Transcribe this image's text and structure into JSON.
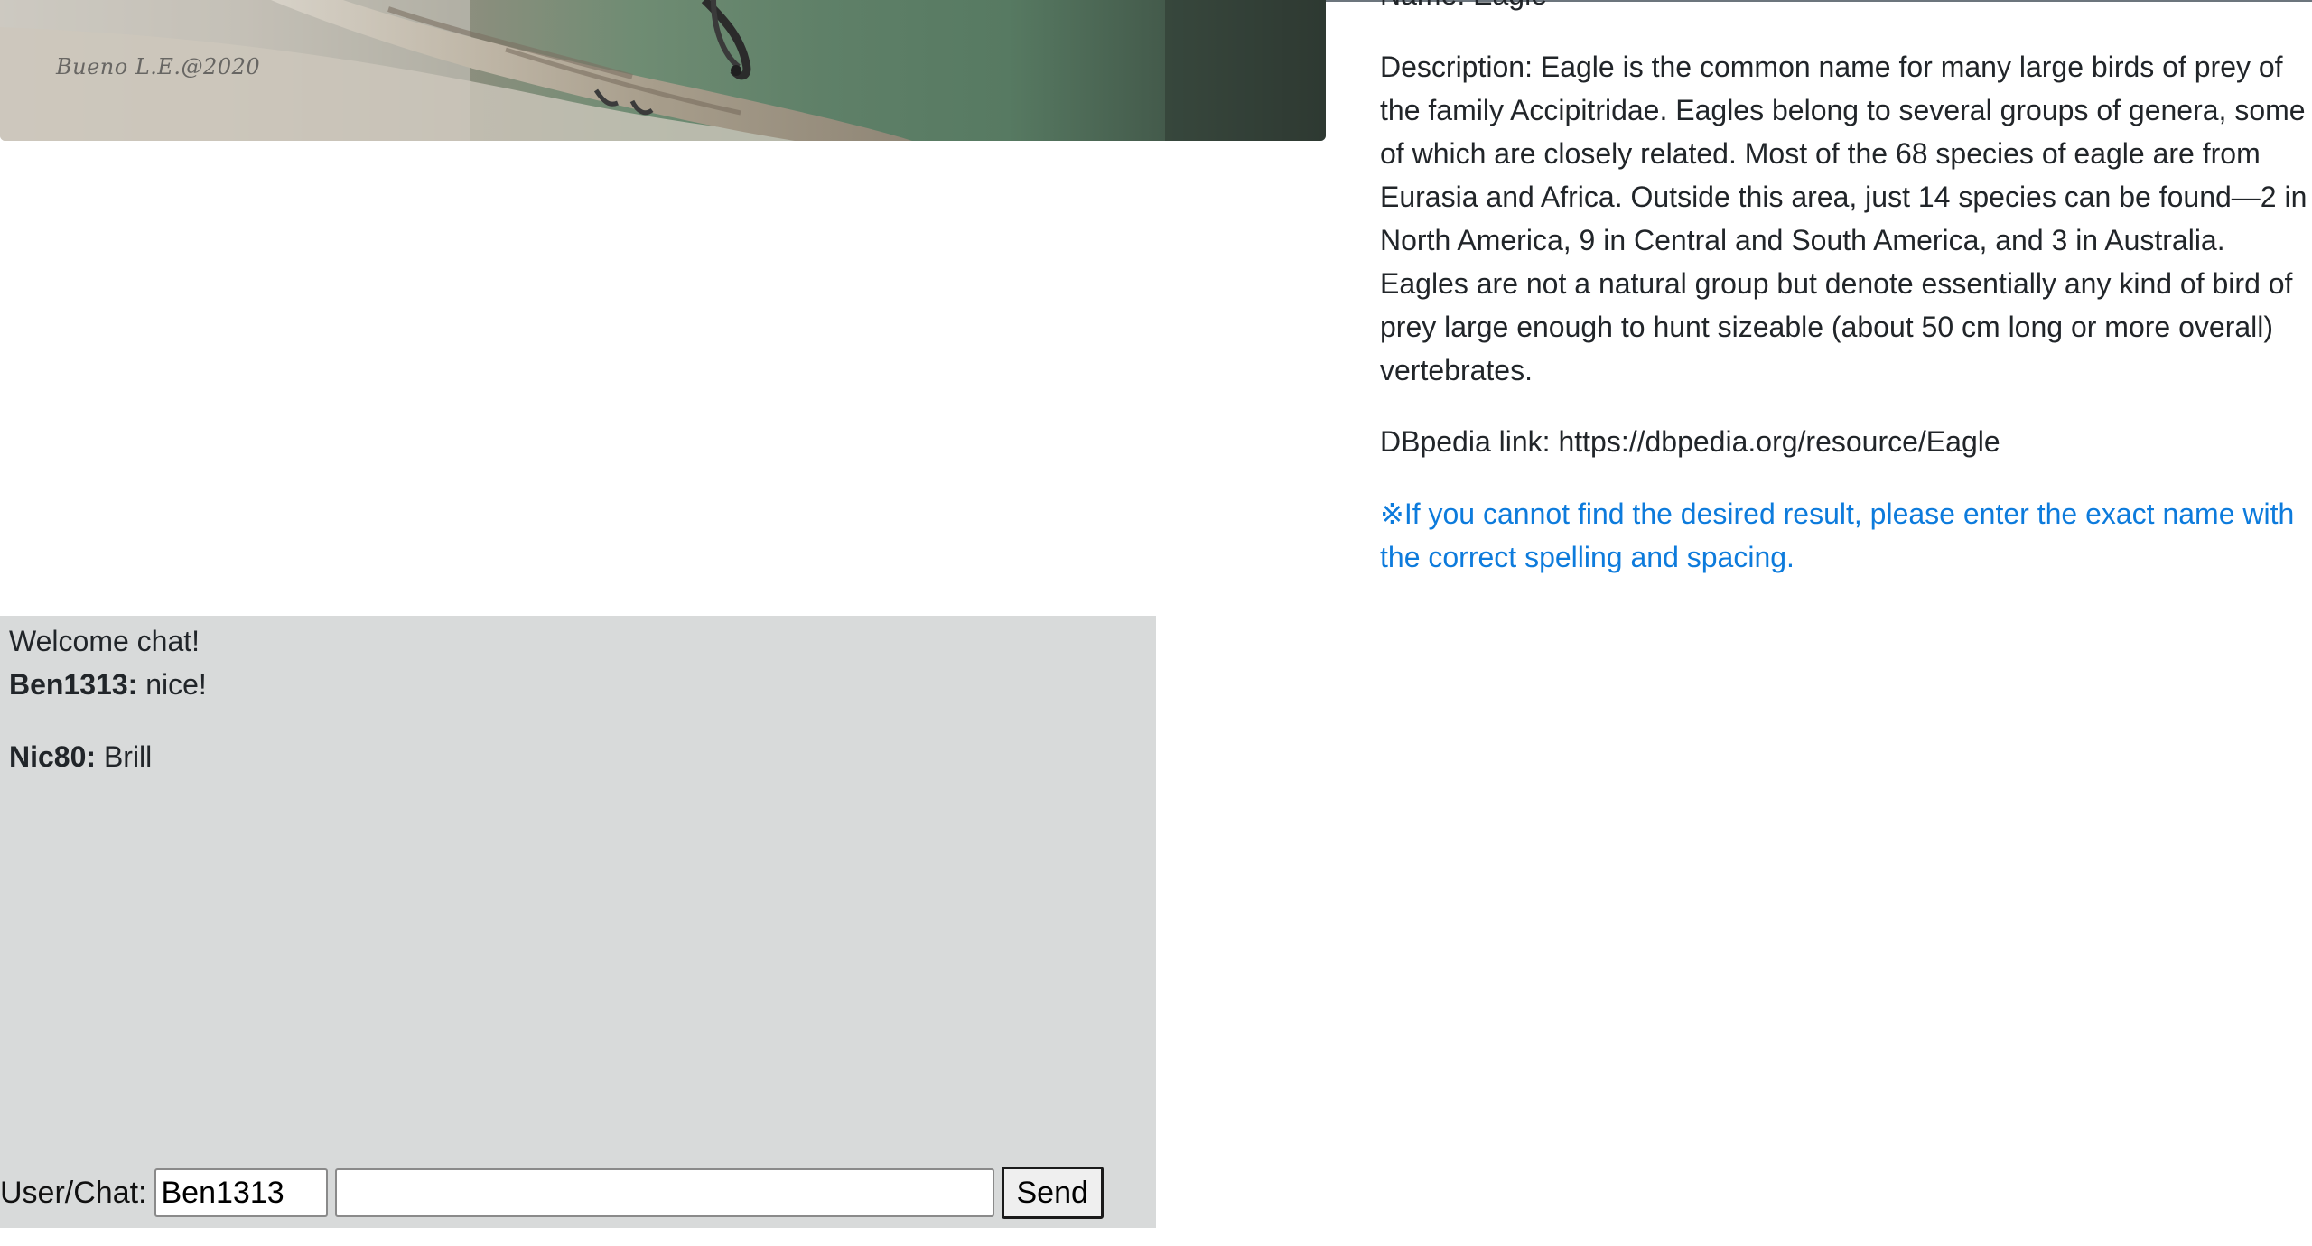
{
  "photo": {
    "watermark": "Bueno L.E.@2020"
  },
  "info": {
    "name_line": "Name: Eagle",
    "description": "Description: Eagle is the common name for many large birds of prey of the family Accipitridae. Eagles belong to several groups of genera, some of which are closely related. Most of the 68 species of eagle are from Eurasia and Africa. Outside this area, just 14 species can be found—2 in North America, 9 in Central and South America, and 3 in Australia. Eagles are not a natural group but denote essentially any kind of bird of prey large enough to hunt sizeable (about 50 cm long or more overall) vertebrates.",
    "dbpedia": "DBpedia link: https://dbpedia.org/resource/Eagle",
    "notice": "※If you cannot find the desired result, please enter the exact name with the correct spelling and spacing.",
    "notice_color": "#0d7bdc"
  },
  "chat": {
    "welcome": "Welcome chat!",
    "messages": [
      {
        "user": "Ben1313:",
        "text": " nice!"
      },
      {
        "user": "Nic80:",
        "text": " Brill"
      }
    ],
    "background": "#d8dada"
  },
  "form": {
    "label": "User/Chat:",
    "username_value": "Ben1313",
    "message_value": "",
    "send_label": "Send"
  }
}
